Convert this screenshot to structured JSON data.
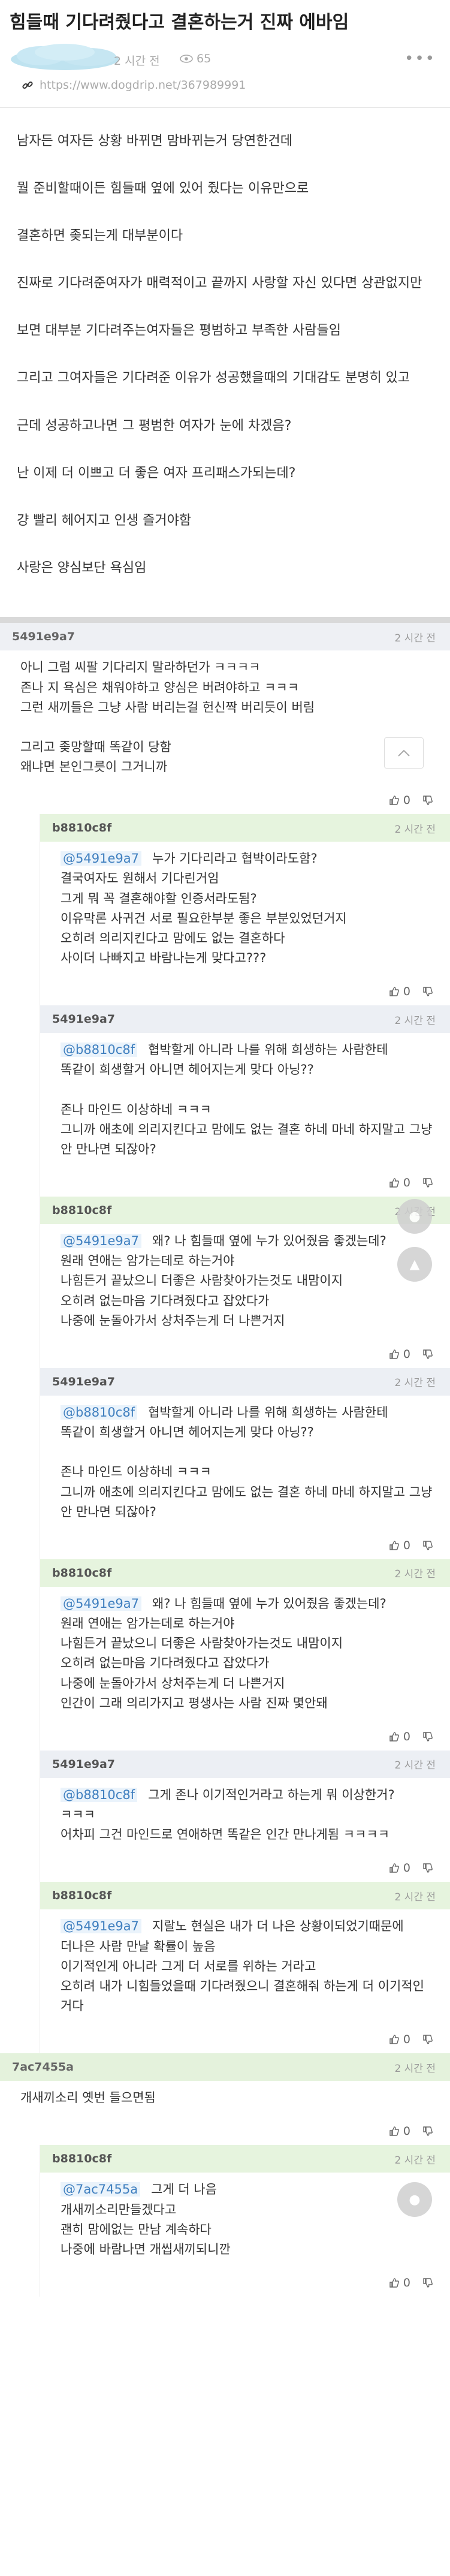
{
  "post": {
    "title": "힘들때 기다려줬다고 결혼하는거 진짜 에바임",
    "time": "2 시간 전",
    "views": "65",
    "url": "https://www.dogdrip.net/367989991",
    "paragraphs": [
      "남자든 여자든 상황 바뀌면 맘바뀌는거 당연한건데",
      "뭘 준비할때이든 힘들때 옆에 있어 줬다는 이유만으로",
      "결혼하면 좆되는게 대부분이다",
      "진짜로 기다려준여자가 매력적이고 끝까지 사랑할 자신 있다면 상관없지만",
      "보면 대부분 기다려주는여자들은 평범하고 부족한 사람들임",
      "그리고 그여자들은 기다려준 이유가 성공했을때의 기대감도 분명히 있고",
      "근데 성공하고나면 그 평범한 여자가 눈에 차겠음?",
      "난 이제 더 이쁘고 더 좋은 여자 프리패스가되는데?",
      "걍 빨리 헤어지고 인생 즐거야함",
      "사랑은 양심보단 욕심임"
    ]
  },
  "icons": {
    "views": "eye-icon",
    "link": "link-icon",
    "more": "more-icon",
    "up": "thumbs-up-icon",
    "down": "thumbs-down-icon",
    "top": "chevron-up-icon",
    "float": "comment-bubble-icon"
  },
  "comments": [
    {
      "author": "5491e9a7",
      "time": "2 시간 전",
      "mention": "",
      "votes": "0",
      "lines": [
        "아니 그럼 씨팔 기다리지 말라하던가 ㅋㅋㅋㅋ",
        "존나 지 욕심은 채워야하고 양심은 버려야하고 ㅋㅋㅋ",
        "그런 새끼들은 그냥 사람 버리는걸 헌신짝 버리듯이 버림",
        "",
        "그리고 좆망할때 똑같이 당함",
        "왜냐면 본인그릇이 그거니까"
      ]
    },
    {
      "author": "b8810c8f",
      "time": "2 시간 전",
      "mention": "@5491e9a7",
      "votes": "0",
      "lines": [
        "누가 기다리라고 협박이라도함?",
        "결국여자도 원해서 기다린거임",
        "그게 뭐 꼭 결혼해야할 인증서라도됨?",
        "이유막론 사귀건 서로 필요한부분 좋은 부분있었던거지",
        "오히려 의리지킨다고 맘에도 없는 결혼하다",
        "사이더 나빠지고 바람나는게 맞다고???"
      ]
    },
    {
      "author": "5491e9a7",
      "time": "2 시간 전",
      "mention": "@b8810c8f",
      "votes": "0",
      "lines": [
        "협박할게 아니라 나를 위해 희생하는 사람한테",
        "똑같이 희생할거 아니면 헤어지는게 맞다 아닝??",
        "",
        "존나 마인드 이상하네 ㅋㅋㅋ",
        "그니까 애초에 의리지킨다고 맘에도 없는 결혼 하네 마네 하지말고 그냥 안 만나면 되잖아?"
      ]
    },
    {
      "author": "b8810c8f",
      "time": "2 시간 전",
      "mention": "@5491e9a7",
      "votes": "0",
      "lines": [
        "왜? 나 힘들때 옆에 누가 있어줬음 좋겠는데?",
        "원래 연애는 암가는데로 하는거야",
        "나힘든거 끝났으니 더좋은 사람찾아가는것도 내맘이지",
        "오히려 없는마음 기다려줬다고 잡았다가",
        "나중에 눈돌아가서 상처주는게 더 나쁜거지"
      ]
    },
    {
      "author": "5491e9a7",
      "time": "2 시간 전",
      "mention": "@b8810c8f",
      "votes": "0",
      "lines": [
        "협박할게 아니라 나를 위해 희생하는 사람한테",
        "똑같이 희생할거 아니면 헤어지는게 맞다 아닝??",
        "",
        "존나 마인드 이상하네 ㅋㅋㅋ",
        "그니까 애초에 의리지킨다고 맘에도 없는 결혼 하네 마네 하지말고 그냥 안 만나면 되잖아?"
      ]
    },
    {
      "author": "b8810c8f",
      "time": "2 시간 전",
      "mention": "@5491e9a7",
      "votes": "0",
      "lines": [
        "왜? 나 힘들때 옆에 누가 있어줬음 좋겠는데?",
        "원래 연애는 암가는데로 하는거야",
        "나힘든거 끝났으니 더좋은 사람찾아가는것도 내맘이지",
        "오히려 없는마음 기다려줬다고 잡았다가",
        "나중에 눈돌아가서 상처주는게 더 나쁜거지",
        "인간이 그래 의리가지고 평생사는 사람 진짜 몇안돼"
      ]
    },
    {
      "author": "5491e9a7",
      "time": "2 시간 전",
      "mention": "@b8810c8f",
      "votes": "0",
      "lines": [
        "그게 존나 이기적인거라고 하는게 뭐 이상한거?",
        "ㅋㅋㅋ",
        "어차피 그건 마인드로 연애하면 똑같은 인간 만나게됨 ㅋㅋㅋㅋ"
      ]
    },
    {
      "author": "b8810c8f",
      "time": "2 시간 전",
      "mention": "@5491e9a7",
      "votes": "0",
      "lines": [
        "지랄노 현실은 내가 더 나은 상황이되었기때문에",
        "더나은 사람 만날 확률이 높음",
        "이기적인게 아니라 그게 더 서로를 위하는 거라고",
        "오히려 내가 니힘들었을때 기다려줬으니 결혼해줘 하는게 더 이기적인거다"
      ]
    },
    {
      "author": "7ac7455a",
      "time": "2 시간 전",
      "mention": "",
      "votes": "0",
      "lines": [
        "개새끼소리 옛번 들으면됨"
      ]
    },
    {
      "author": "b8810c8f",
      "time": "2 시간 전",
      "mention": "@7ac7455a",
      "votes": "0",
      "lines": [
        "그게 더 나음",
        "개새끼소리만들겠다고",
        "괜히 맘에없는 만남 계속하다",
        "나중에 바람나면 개씹새끼되니깐"
      ]
    }
  ]
}
